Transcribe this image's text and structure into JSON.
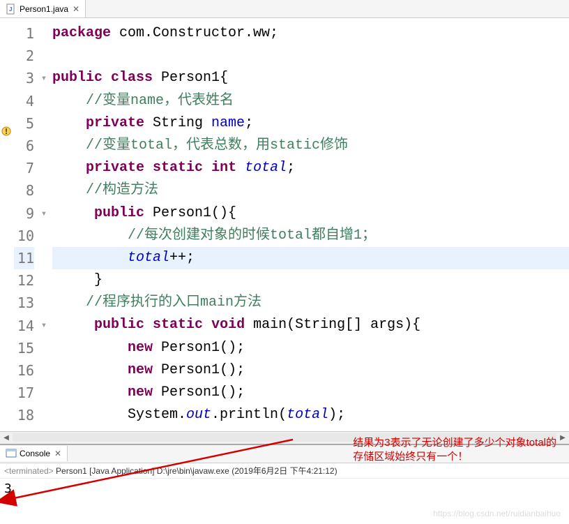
{
  "tab": {
    "filename": "Person1.java",
    "close": "✕"
  },
  "code": {
    "lines": [
      {
        "n": "1",
        "segs": [
          [
            "kw",
            "package"
          ],
          [
            "",
            " com.Constructor.ww;"
          ]
        ]
      },
      {
        "n": "2",
        "segs": []
      },
      {
        "n": "3",
        "segs": [
          [
            "kw",
            "public"
          ],
          [
            "",
            " "
          ],
          [
            "kw",
            "class"
          ],
          [
            "",
            " Person1{"
          ]
        ]
      },
      {
        "n": "4",
        "segs": [
          [
            "",
            "    "
          ],
          [
            "cm",
            "//变量name，代表姓名"
          ]
        ]
      },
      {
        "n": "5",
        "segs": [
          [
            "",
            "    "
          ],
          [
            "kw",
            "private"
          ],
          [
            "",
            " String "
          ],
          [
            "fld",
            "name"
          ],
          [
            "",
            ";"
          ]
        ]
      },
      {
        "n": "6",
        "segs": [
          [
            "",
            "    "
          ],
          [
            "cm",
            "//变量total，代表总数，用static修饰"
          ]
        ]
      },
      {
        "n": "7",
        "segs": [
          [
            "",
            "    "
          ],
          [
            "kw",
            "private"
          ],
          [
            "",
            " "
          ],
          [
            "kw",
            "static"
          ],
          [
            "",
            " "
          ],
          [
            "kw",
            "int"
          ],
          [
            "",
            " "
          ],
          [
            "sf",
            "total"
          ],
          [
            "",
            ";"
          ]
        ]
      },
      {
        "n": "8",
        "segs": [
          [
            "",
            "    "
          ],
          [
            "cm",
            "//构造方法"
          ]
        ]
      },
      {
        "n": "9",
        "segs": [
          [
            "",
            "     "
          ],
          [
            "kw",
            "public"
          ],
          [
            "",
            " Person1(){"
          ]
        ]
      },
      {
        "n": "10",
        "segs": [
          [
            "",
            "         "
          ],
          [
            "cm",
            "//每次创建对象的时候total都自增1；"
          ]
        ]
      },
      {
        "n": "11",
        "hl": true,
        "segs": [
          [
            "",
            "         "
          ],
          [
            "sf",
            "total"
          ],
          [
            "",
            "++;"
          ]
        ]
      },
      {
        "n": "12",
        "segs": [
          [
            "",
            "     }"
          ]
        ]
      },
      {
        "n": "13",
        "segs": [
          [
            "",
            "    "
          ],
          [
            "cm",
            "//程序执行的入口main方法"
          ]
        ]
      },
      {
        "n": "14",
        "segs": [
          [
            "",
            "     "
          ],
          [
            "kw",
            "public"
          ],
          [
            "",
            " "
          ],
          [
            "kw",
            "static"
          ],
          [
            "",
            " "
          ],
          [
            "kw",
            "void"
          ],
          [
            "",
            " main(String[] args){"
          ]
        ]
      },
      {
        "n": "15",
        "segs": [
          [
            "",
            "         "
          ],
          [
            "kw",
            "new"
          ],
          [
            "",
            " Person1();"
          ]
        ]
      },
      {
        "n": "16",
        "segs": [
          [
            "",
            "         "
          ],
          [
            "kw",
            "new"
          ],
          [
            "",
            " Person1();"
          ]
        ]
      },
      {
        "n": "17",
        "segs": [
          [
            "",
            "         "
          ],
          [
            "kw",
            "new"
          ],
          [
            "",
            " Person1();"
          ]
        ]
      },
      {
        "n": "18",
        "segs": [
          [
            "",
            "         System."
          ],
          [
            "sf",
            "out"
          ],
          [
            "",
            ".println("
          ],
          [
            "sf",
            "total"
          ],
          [
            "",
            ");"
          ]
        ]
      }
    ]
  },
  "console": {
    "tab_label": "Console",
    "status_prefix": "<terminated>",
    "status_text": " Person1 [Java Application] D:\\jre\\bin\\javaw.exe (2019年6月2日 下午4:21:12)",
    "output": "3"
  },
  "annotation": {
    "line1": "结果为3表示了无论创建了多少个对象total的",
    "line2": "存储区域始终只有一个！"
  },
  "watermark": "https://blog.csdn.net/ruidianbaihuo"
}
